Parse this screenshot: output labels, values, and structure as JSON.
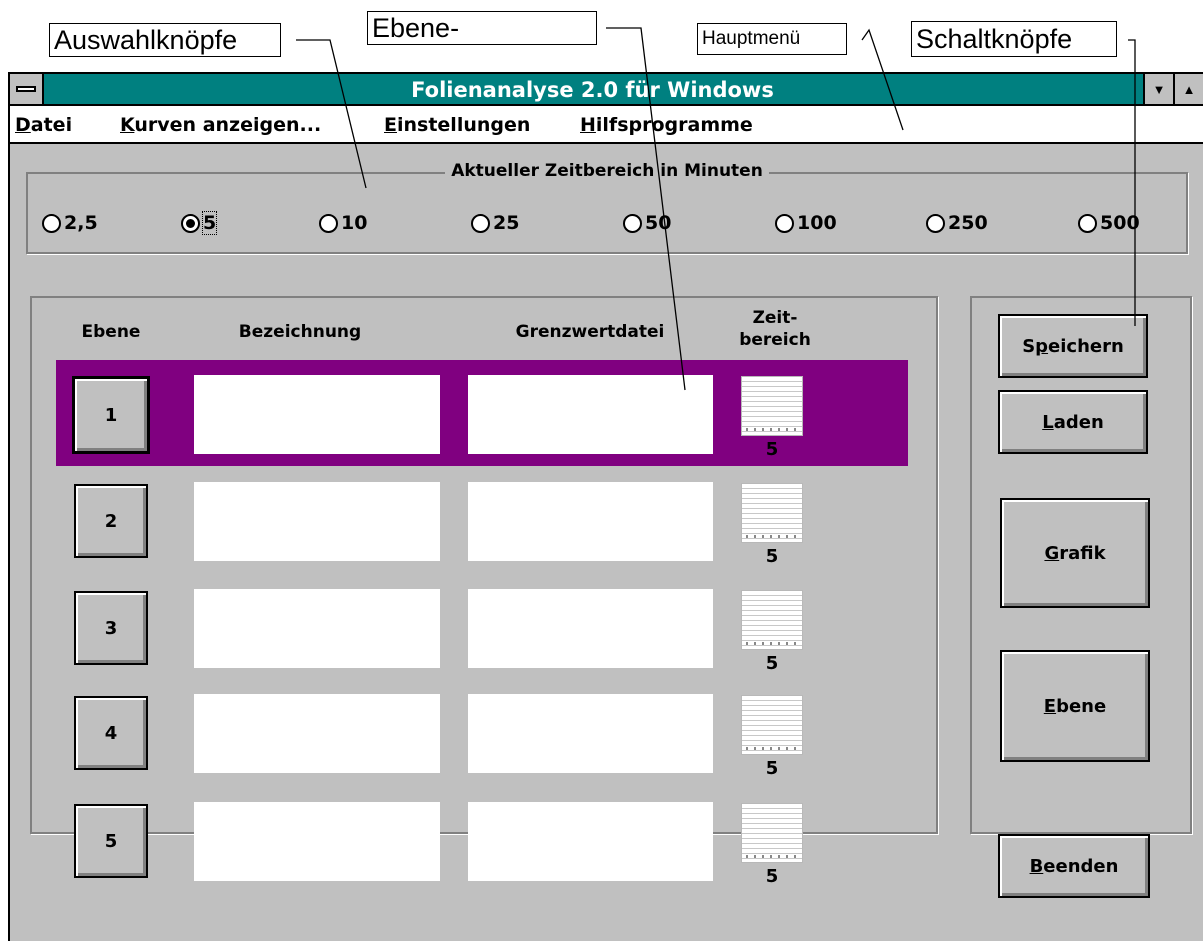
{
  "annotations": {
    "auswahlknoepfe": "Auswahlknöpfe",
    "ebene": "Ebene-",
    "hauptmenue": "Hauptmenü",
    "schaltknoepfe": "Schaltknöpfe"
  },
  "window": {
    "title": "Folienanalyse 2.0 für Windows",
    "min_glyph": "▼",
    "max_glyph": "▲"
  },
  "menu": {
    "datei": {
      "mnemonic": "D",
      "rest": "atei"
    },
    "kurven": {
      "mnemonic": "K",
      "rest": "urven anzeigen..."
    },
    "einstellungen": {
      "mnemonic": "E",
      "rest": "instellungen"
    },
    "hilfsprogramme": {
      "mnemonic": "H",
      "rest": "ilfsprogramme"
    }
  },
  "zeitbereich": {
    "legend": "Aktueller Zeitbereich in Minuten",
    "selected": "5",
    "options": [
      "2,5",
      "5",
      "10",
      "25",
      "50",
      "100",
      "250",
      "500"
    ]
  },
  "table": {
    "headers": {
      "ebene": "Ebene",
      "bezeichnung": "Bezeichnung",
      "grenzwertdatei": "Grenzwertdatei",
      "zeitbereich_1": "Zeit-",
      "zeitbereich_2": "bereich"
    },
    "selected_row": 1,
    "rows": [
      {
        "level": "1",
        "bezeichnung": "",
        "grenzwertdatei": "",
        "zeitbereich": "5"
      },
      {
        "level": "2",
        "bezeichnung": "",
        "grenzwertdatei": "",
        "zeitbereich": "5"
      },
      {
        "level": "3",
        "bezeichnung": "",
        "grenzwertdatei": "",
        "zeitbereich": "5"
      },
      {
        "level": "4",
        "bezeichnung": "",
        "grenzwertdatei": "",
        "zeitbereich": "5"
      },
      {
        "level": "5",
        "bezeichnung": "",
        "grenzwertdatei": "",
        "zeitbereich": "5"
      }
    ]
  },
  "buttons": {
    "speichern": {
      "before": "S",
      "mnemonic": "p",
      "after": "eichern"
    },
    "laden": {
      "before": "",
      "mnemonic": "L",
      "after": "aden"
    },
    "grafik": {
      "before": "",
      "mnemonic": "G",
      "after": "rafik"
    },
    "ebene": {
      "before": "",
      "mnemonic": "E",
      "after": "bene"
    },
    "beenden": {
      "before": "",
      "mnemonic": "B",
      "after": "eenden"
    }
  },
  "colors": {
    "titlebar": "#008080",
    "selected_row": "#800080",
    "window_bg": "#c0c0c0"
  }
}
